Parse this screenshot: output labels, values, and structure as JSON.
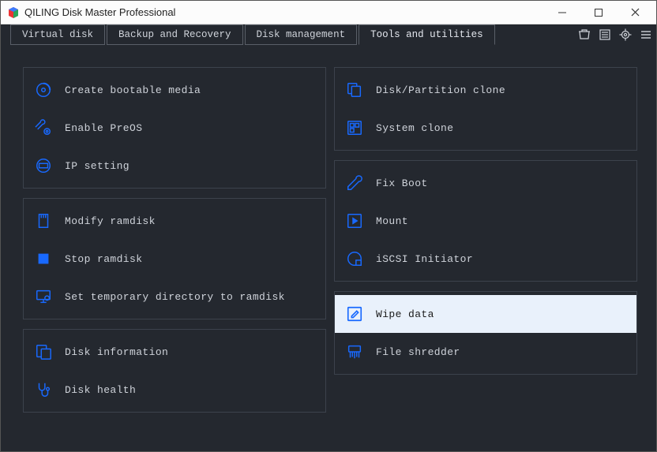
{
  "window": {
    "title": "QILING Disk Master Professional"
  },
  "tabs": {
    "virtual_disk": "Virtual disk",
    "backup_recovery": "Backup and Recovery",
    "disk_management": "Disk management",
    "tools_utilities": "Tools and utilities"
  },
  "left": {
    "group1": {
      "bootable": "Create bootable media",
      "preos": "Enable PreOS",
      "ip": "IP setting"
    },
    "group2": {
      "modify_ramdisk": "Modify ramdisk",
      "stop_ramdisk": "Stop ramdisk",
      "temp_dir": "Set temporary directory to ramdisk"
    },
    "group3": {
      "disk_info": "Disk information",
      "disk_health": "Disk health"
    }
  },
  "right": {
    "group1": {
      "clone": "Disk/Partition clone",
      "system_clone": "System clone"
    },
    "group2": {
      "fixboot": "Fix Boot",
      "mount": "Mount",
      "iscsi": "iSCSI Initiator"
    },
    "group3": {
      "wipe": "Wipe data",
      "shredder": "File shredder"
    }
  },
  "colors": {
    "accent": "#1869ff",
    "bg": "#24282f",
    "panel_border": "#3c424c",
    "text": "#cfd3da",
    "selected_bg": "#e9f1fb"
  }
}
